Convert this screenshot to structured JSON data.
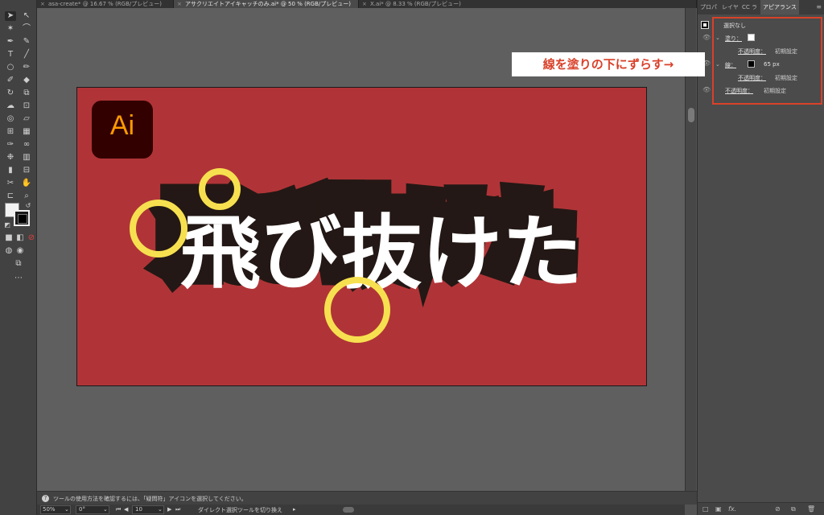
{
  "tabs": [
    {
      "label": "asa-create* @ 16.67 % (RGB/プレビュー)",
      "active": false
    },
    {
      "label": "アサクリエイトアイキャッチのみ.ai* @ 50 % (RGB/プレビュー)",
      "active": true
    },
    {
      "label": "X.ai* @ 8.33 % (RGB/プレビュー)",
      "active": false
    }
  ],
  "artboard": {
    "logo_text": "Ai",
    "headline": "飛び抜けた",
    "colors": {
      "background": "#b03437",
      "text": "#ffffff",
      "offset_stroke": "#231815",
      "highlight_circles": "#f7e04f"
    }
  },
  "panel": {
    "tabs": [
      "プロパ",
      "レイヤ",
      "CC ラ",
      "アピアランス"
    ],
    "active_tab": "アピアランス",
    "menu_icon": "panel-menu-icon",
    "selection_label": "選択なし",
    "fill_label": "塗り：",
    "fill_opacity_label": "不透明度：",
    "fill_opacity_value": "初期設定",
    "stroke_label": "線：",
    "stroke_width": "65 px",
    "stroke_opacity_label": "不透明度：",
    "stroke_opacity_value": "初期設定",
    "object_opacity_label": "不透明度：",
    "object_opacity_value": "初期設定",
    "bottom_icons": [
      "add-stroke-icon",
      "add-fill-icon",
      "fx-icon",
      "clear-appearance-icon",
      "duplicate-item-icon",
      "delete-item-icon"
    ]
  },
  "callout": {
    "text": "線を塗りの下にずらす→",
    "color": "#d9412a"
  },
  "status": {
    "hint": "ツールの使用方法を確認するには、「疑問符」アイコンを選択してください。"
  },
  "bottom": {
    "zoom": "50%",
    "rotation": "0°",
    "artboard_number": "10",
    "tool_status": "ダイレクト選択ツールを切り換え"
  }
}
